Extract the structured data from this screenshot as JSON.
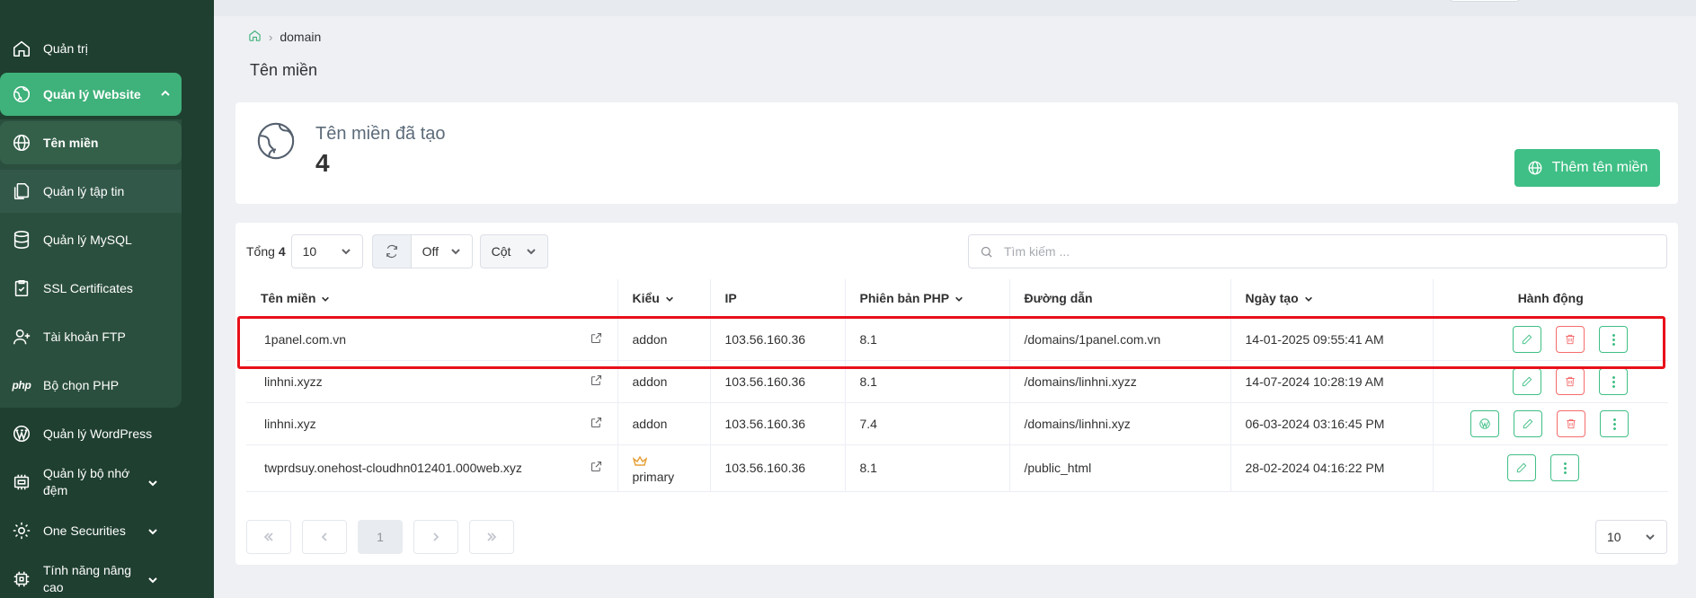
{
  "sidebar": {
    "items": [
      {
        "label": "Quản trị",
        "icon": "home-icon"
      },
      {
        "label": "Quản lý Website",
        "icon": "globe-outline-icon"
      },
      {
        "label": "Tên miền",
        "icon": "globe-icon"
      },
      {
        "label": "Quản lý tập tin",
        "icon": "files-icon"
      },
      {
        "label": "Quản lý MySQL",
        "icon": "database-icon"
      },
      {
        "label": "SSL Certificates",
        "icon": "clipboard-check-icon"
      },
      {
        "label": "Tài khoản FTP",
        "icon": "user-plus-icon"
      },
      {
        "label": "Bộ chọn PHP",
        "icon": "php-icon"
      },
      {
        "label": "Quản lý WordPress",
        "icon": "wordpress-icon"
      },
      {
        "label": "Quản lý bộ nhớ đệm",
        "icon": "memory-icon"
      },
      {
        "label": "One Securities",
        "icon": "gear-icon"
      },
      {
        "label": "Tính năng nâng cao",
        "icon": "chip-icon"
      }
    ]
  },
  "breadcrumb": {
    "current": "domain"
  },
  "page": {
    "title": "Tên miền"
  },
  "stat": {
    "label": "Tên miền đã tạo",
    "value": "4"
  },
  "add_button": {
    "label": "Thêm tên miền"
  },
  "toolbar": {
    "total_label": "Tổng",
    "total_value": "4",
    "page_size": "10",
    "auto_refresh": "Off",
    "columns_label": "Cột"
  },
  "search": {
    "placeholder": "Tìm kiếm ..."
  },
  "table": {
    "headers": {
      "domain": "Tên miền",
      "type": "Kiểu",
      "ip": "IP",
      "php": "Phiên bản PHP",
      "path": "Đường dẫn",
      "created": "Ngày tạo",
      "actions": "Hành động"
    },
    "rows": [
      {
        "domain": "1panel.com.vn",
        "type": "addon",
        "ip": "103.56.160.36",
        "php": "8.1",
        "path": "/domains/1panel.com.vn",
        "created": "14-01-2025 09:55:41 AM"
      },
      {
        "domain": "linhni.xyzz",
        "type": "addon",
        "ip": "103.56.160.36",
        "php": "8.1",
        "path": "/domains/linhni.xyzz",
        "created": "14-07-2024 10:28:19 AM"
      },
      {
        "domain": "linhni.xyz",
        "type": "addon",
        "ip": "103.56.160.36",
        "php": "7.4",
        "path": "/domains/linhni.xyz",
        "created": "06-03-2024 03:16:45 PM"
      },
      {
        "domain": "twprdsuy.onehost-cloudhn012401.000web.xyz",
        "type": "primary",
        "ip": "103.56.160.36",
        "php": "8.1",
        "path": "/public_html",
        "created": "28-02-2024 04:16:22 PM"
      }
    ]
  },
  "pagination": {
    "current_page": "1",
    "page_size": "10"
  },
  "colors": {
    "sidebar_bg": "#1f3f30",
    "accent": "#3fbf85",
    "danger": "#f56c6c",
    "highlight": "#e8101a"
  }
}
